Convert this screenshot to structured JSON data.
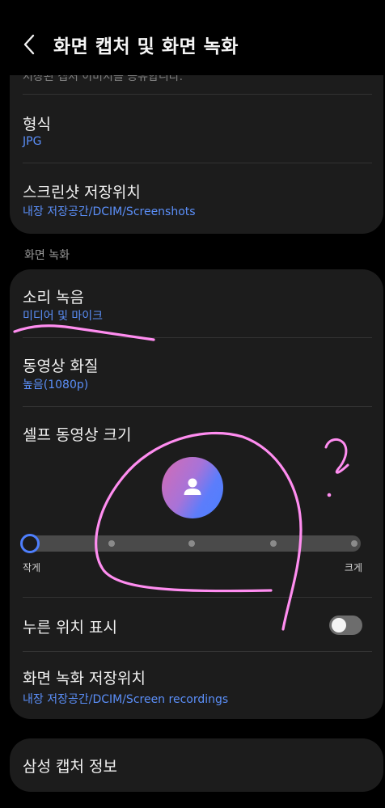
{
  "header": {
    "title": "화면 캡처 및 화면 녹화"
  },
  "top_card": {
    "cut_text": "저장된 캡처 이미지를 공유합니다.",
    "format": {
      "title": "형식",
      "value": "JPG"
    },
    "screenshot_location": {
      "title": "스크린샷 저장위치",
      "value": "내장 저장공간/DCIM/Screenshots"
    }
  },
  "recording": {
    "section_title": "화면 녹화",
    "sound": {
      "title": "소리 녹음",
      "value": "미디어 및 마이크"
    },
    "quality": {
      "title": "동영상 화질",
      "value": "높음(1080p)"
    },
    "selfie_size": {
      "title": "셀프 동영상 크기",
      "min_label": "작게",
      "max_label": "크게",
      "steps": 5,
      "selected_step": 1
    },
    "show_taps": {
      "title": "누른 위치 표시",
      "enabled": false
    },
    "recording_location": {
      "title": "화면 녹화 저장위치",
      "value": "내장 저장공간/DCIM/Screen recordings"
    }
  },
  "about": {
    "title": "삼성 캡처 정보"
  },
  "annotation": {
    "text": "?"
  },
  "colors": {
    "background": "#000000",
    "card": "#1c1c1c",
    "accent": "#4e7ffd",
    "annotation": "#ff8df0"
  }
}
